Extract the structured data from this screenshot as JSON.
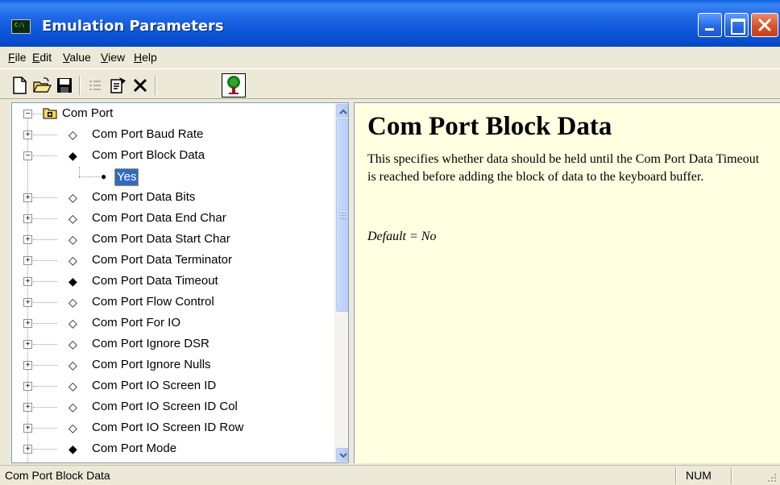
{
  "window": {
    "title": "Emulation Parameters",
    "app_icon": "terminal-icon",
    "controls": [
      "minimize-icon",
      "maximize-icon",
      "close-icon"
    ]
  },
  "menubar": {
    "items": [
      {
        "label": "File",
        "mnemonic": "F",
        "rest": "ile"
      },
      {
        "label": "Edit",
        "mnemonic": "E",
        "rest": "dit"
      },
      {
        "label": "Value",
        "mnemonic": "V",
        "rest": "alue"
      },
      {
        "label": "View",
        "mnemonic": "V",
        "rest": "iew"
      },
      {
        "label": "Help",
        "mnemonic": "H",
        "rest": "elp"
      }
    ]
  },
  "toolbar": {
    "icons": [
      "new-document-icon",
      "open-folder-icon",
      "save-icon",
      "list-disabled-icon",
      "properties-icon",
      "delete-icon",
      "tree-view-icon"
    ]
  },
  "tree": {
    "root": {
      "label": "Com Port",
      "icon": "folder-icon",
      "expanded": true
    },
    "items": [
      {
        "label": "Com Port Baud Rate",
        "marker": "◇",
        "expanded": false
      },
      {
        "label": "Com Port Block Data",
        "marker": "◆",
        "expanded": true,
        "children": [
          {
            "label": "Yes",
            "marker": "●",
            "selected": true
          }
        ]
      },
      {
        "label": "Com Port Data Bits",
        "marker": "◇",
        "expanded": false
      },
      {
        "label": "Com Port Data End Char",
        "marker": "◇",
        "expanded": false
      },
      {
        "label": "Com Port Data Start Char",
        "marker": "◇",
        "expanded": false
      },
      {
        "label": "Com Port Data Terminator",
        "marker": "◇",
        "expanded": false
      },
      {
        "label": "Com Port Data Timeout",
        "marker": "◆",
        "expanded": false
      },
      {
        "label": "Com Port Flow Control",
        "marker": "◇",
        "expanded": false
      },
      {
        "label": "Com Port For IO",
        "marker": "◇",
        "expanded": false
      },
      {
        "label": "Com Port Ignore DSR",
        "marker": "◇",
        "expanded": false
      },
      {
        "label": "Com Port Ignore Nulls",
        "marker": "◇",
        "expanded": false
      },
      {
        "label": "Com Port IO Screen ID",
        "marker": "◇",
        "expanded": false
      },
      {
        "label": "Com Port IO Screen ID Col",
        "marker": "◇",
        "expanded": false
      },
      {
        "label": "Com Port IO Screen ID Row",
        "marker": "◇",
        "expanded": false
      },
      {
        "label": "Com Port Mode",
        "marker": "◆",
        "expanded": false
      }
    ]
  },
  "description": {
    "title": "Com Port Block Data",
    "body": "This specifies whether data should be held until the Com Port Data Timeout is reached before adding the block of data to the keyboard buffer.",
    "default": "Default = No"
  },
  "statusbar": {
    "text": "Com Port Block Data",
    "num": "NUM"
  },
  "colors": {
    "titlebar": "#0a5fdf",
    "selection": "#316ac5",
    "description_bg": "#ffffe1"
  }
}
